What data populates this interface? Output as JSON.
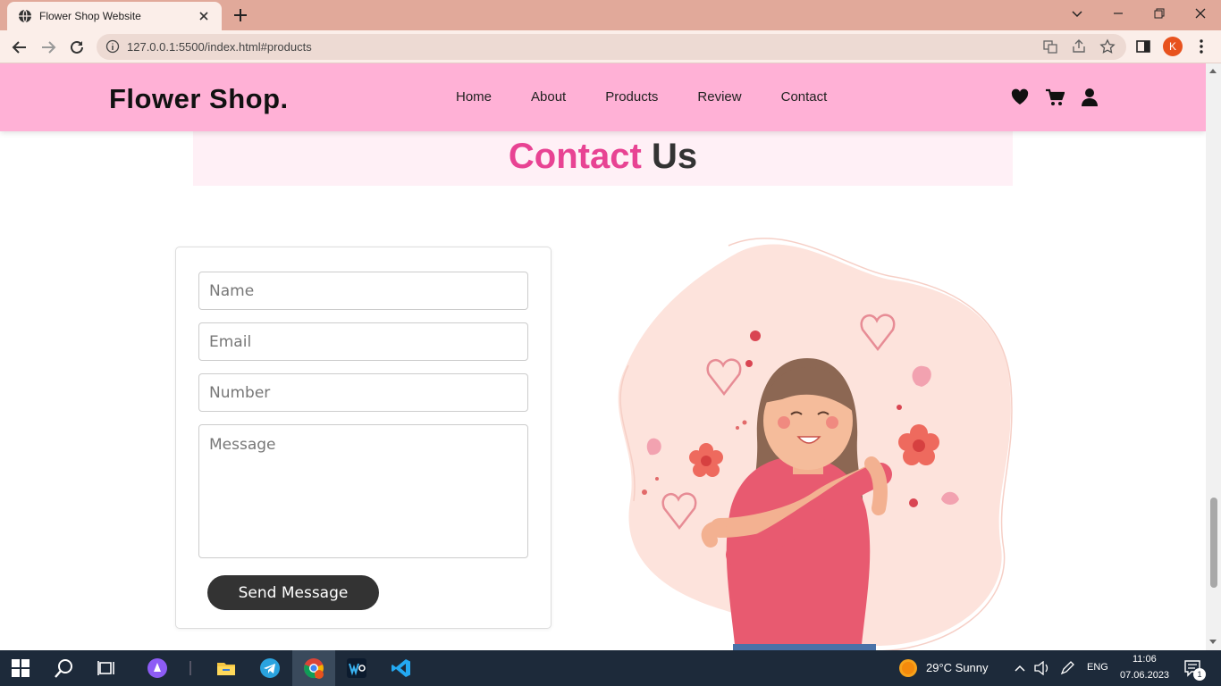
{
  "browser": {
    "tab_title": "Flower Shop Website",
    "url": "127.0.0.1:5500/index.html#products",
    "profile_initial": "K"
  },
  "site": {
    "logo": "Flower Shop.",
    "nav": [
      "Home",
      "About",
      "Products",
      "Review",
      "Contact"
    ],
    "header_bg": "#ffb1d6",
    "accent": "#e84393"
  },
  "contact": {
    "heading_accent": "Contact",
    "heading_rest": "Us",
    "placeholders": {
      "name": "Name",
      "email": "Email",
      "number": "Number",
      "message": "Message"
    },
    "button": "Send Message"
  },
  "taskbar": {
    "weather": "29°C  Sunny",
    "lang": "ENG",
    "time": "11:06",
    "date": "07.06.2023",
    "notification_count": "1"
  }
}
